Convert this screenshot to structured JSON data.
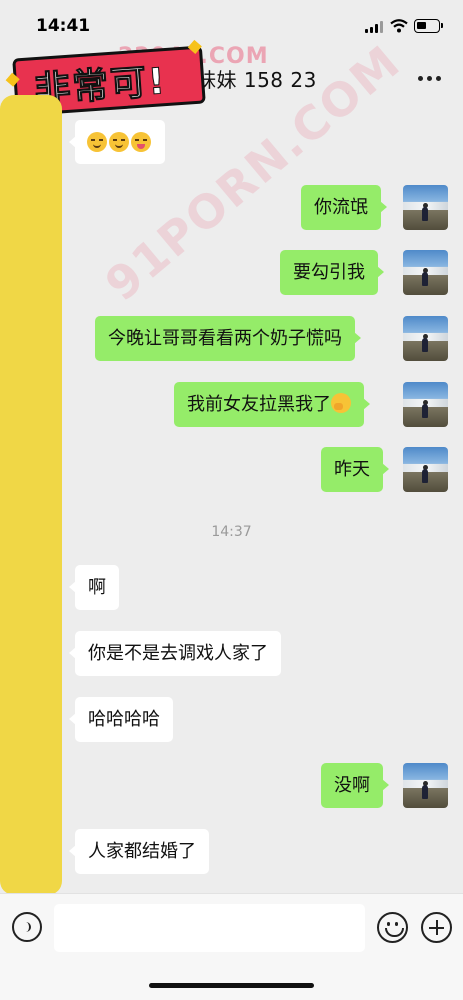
{
  "status_bar": {
    "time": "14:41"
  },
  "header": {
    "title": "妹妹  158  23",
    "watermark_site": "22042.COM",
    "logo_text": "非常可!"
  },
  "overlay": {
    "diagonal_watermark": "91PORN.COM",
    "watermark_color": "#e8788c"
  },
  "colors": {
    "sent_bubble": "#95ec69",
    "received_bubble": "#ffffff",
    "background": "#ededed",
    "censor_bar": "#f0d746"
  },
  "messages": [
    {
      "side": "them",
      "kind": "emoji",
      "emojis": [
        "angry-face-icon",
        "angry-face-icon",
        "tongue-wink-face-icon"
      ]
    },
    {
      "side": "me",
      "text": "你流氓"
    },
    {
      "side": "me",
      "text": "要勾引我"
    },
    {
      "side": "me",
      "text": "今晚让哥哥看看两个奶子慌吗"
    },
    {
      "side": "me",
      "text": "我前女友拉黑我了",
      "trailing_emoji": "thinking-face-icon"
    },
    {
      "side": "me",
      "text": "昨天"
    },
    {
      "side": "them",
      "text": "啊"
    },
    {
      "side": "them",
      "text": "你是不是去调戏人家了"
    },
    {
      "side": "them",
      "text": "哈哈哈哈"
    },
    {
      "side": "me",
      "text": "没啊"
    },
    {
      "side": "them",
      "text": "人家都结婚了"
    }
  ],
  "timestamp": "14:37",
  "input_bar": {
    "placeholder": "",
    "icons": [
      "voice-icon",
      "emoji-icon",
      "plus-icon"
    ]
  }
}
